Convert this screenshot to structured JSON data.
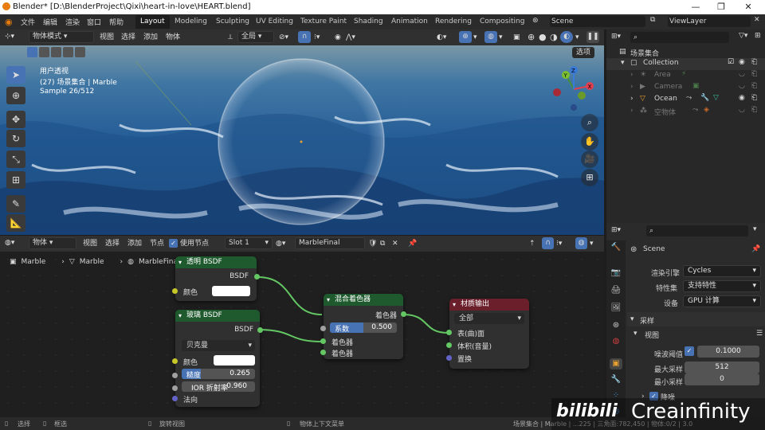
{
  "titlebar": {
    "title": "Blender* [D:\\BlenderProject\\Qixi\\heart-in-love\\HEART.blend]"
  },
  "menu": [
    "文件",
    "编辑",
    "渲染",
    "窗口",
    "帮助"
  ],
  "workspaces": [
    "Layout",
    "Modeling",
    "Sculpting",
    "UV Editing",
    "Texture Paint",
    "Shading",
    "Animation",
    "Rendering",
    "Compositing"
  ],
  "scene_name": "Scene",
  "view_layer": "ViewLayer",
  "viewport_header": {
    "mode": "物体模式",
    "items": [
      "视图",
      "选择",
      "添加",
      "物体"
    ],
    "transform": "全局",
    "options": "选项"
  },
  "viewport": {
    "view_name": "用户透视",
    "collection_info": "(27) 场景集合 | Marble",
    "sample": "Sample 26/512"
  },
  "outliner": {
    "root": "场景集合",
    "items": [
      {
        "name": "Collection",
        "level": 1
      },
      {
        "name": "Area",
        "level": 2
      },
      {
        "name": "Camera",
        "level": 2
      },
      {
        "name": "Ocean",
        "level": 2
      },
      {
        "name": "空物体",
        "level": 2
      }
    ]
  },
  "properties": {
    "scene": "Scene",
    "render_engine_label": "渲染引擎",
    "render_engine": "Cycles",
    "feature_set_label": "特性集",
    "feature_set": "支持特性",
    "device_label": "设备",
    "device": "GPU 计算",
    "sampling": "采样",
    "viewport_sub": "视图",
    "noise_threshold_label": "噪波阈值",
    "noise_threshold": "0.1000",
    "max_samples_label": "最大采样",
    "max_samples": "512",
    "min_samples_label": "最小采样",
    "min_samples": "0",
    "denoise": "降噪"
  },
  "node_header": {
    "type": "物体",
    "items": [
      "视图",
      "选择",
      "添加",
      "节点"
    ],
    "use_nodes": "使用节点",
    "slot": "Slot 1",
    "material": "MarbleFinal"
  },
  "breadcrumb": [
    "Marble",
    "Marble",
    "MarbleFinal"
  ],
  "nodes": {
    "transparent": {
      "title": "透明 BSDF",
      "out": "BSDF",
      "color": "颜色"
    },
    "glass": {
      "title": "玻璃 BSDF",
      "out": "BSDF",
      "distribution": "贝克曼",
      "color": "颜色",
      "roughness_label": "糙度",
      "roughness": "0.265",
      "ior_label": "IOR 折射率",
      "ior": "0.960",
      "normal": "法向"
    },
    "mix": {
      "title": "混合着色器",
      "out": "着色器",
      "fac_label": "系数",
      "fac": "0.500",
      "shader1": "着色器",
      "shader2": "着色器"
    },
    "output": {
      "title": "材质输出",
      "target": "全部",
      "surface": "表(曲)面",
      "volume": "体积(音量)",
      "displacement": "置换"
    }
  },
  "status": {
    "select": "选择",
    "box": "框选",
    "rotate": "旋转视图",
    "context": "物体上下文菜单",
    "stats": "场景集合 | Marble | ...225 | 三角面:782,450 | 物体:0/2 | 3.0"
  },
  "watermark": "Creainfinity"
}
